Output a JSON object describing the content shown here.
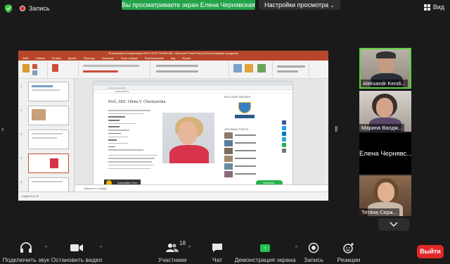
{
  "topbar": {
    "recording_label": "Запись",
    "share_banner": "Вы просматриваете экран Елена Чернявская",
    "view_settings_label": "Настройки просмотра",
    "view_button_label": "Вид"
  },
  "shared_screen": {
    "app": "Microsoft PowerPoint",
    "window_title": "Presentation Конференция МСН 2020 ТЕАМ8 МБ - Microsoft PowerPoint (Сбой активации продукта)",
    "ribbon_tabs": [
      "Файл",
      "Главная",
      "Вставка",
      "Дизайн",
      "Переходы",
      "Анимация",
      "Показ слайдов",
      "Рецензирование",
      "Вид",
      "Формат"
    ],
    "thumbnail_numbers": [
      "1",
      "2",
      "3",
      "4",
      "5"
    ],
    "browser_url": "ucrs.ivn.nure.ua/ru/...",
    "page_nav": [
      "Главная",
      "Войти"
    ],
    "profile_name": "Prof., DrE. Olena V. Chernyavska",
    "sidebar_partner_title": "EXCLUSIVE PARTNER",
    "sidebar_events_title": "UPCOMING EVENTS",
    "subscription_label": "Subscription Form",
    "whatsapp_label": "WhatsApp",
    "notes_placeholder": "Заметки к слайду",
    "status_text": "Слайд 25 из 33"
  },
  "participants": [
    {
      "name": "Aleksandr Kendi...",
      "video": true,
      "active": true
    },
    {
      "name": "Марина Валдж...",
      "video": true,
      "active": false
    },
    {
      "name": "Елена  Чернявс...",
      "video": false,
      "active": false
    },
    {
      "name": "Тетяна Серж...",
      "video": true,
      "active": false
    }
  ],
  "toolbar": {
    "audio_label": "Подключить звук",
    "video_label": "Остановить видео",
    "participants_label": "Участники",
    "participants_count": "18",
    "chat_label": "Чат",
    "share_label": "Демонстрация экрана",
    "record_label": "Запись",
    "reactions_label": "Реакции",
    "leave_label": "Выйти"
  },
  "colors": {
    "share_green": "#23a44a",
    "active_speaker": "#5cd040",
    "leave_red": "#e02828",
    "powerpoint_red": "#b7472a"
  }
}
